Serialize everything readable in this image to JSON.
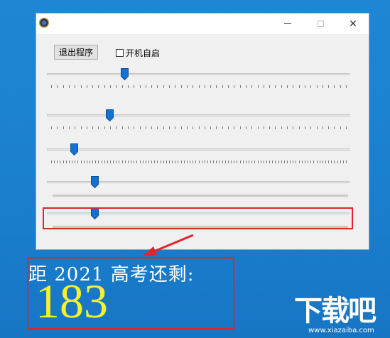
{
  "window": {
    "controls": {
      "close_glyph": "✕"
    }
  },
  "toolbar": {
    "exit_label": "退出程序",
    "autostart_label": "开机自启",
    "autostart_checked": false
  },
  "sliders": [
    {
      "value": 0.25,
      "has_ticks": true
    },
    {
      "value": 0.2,
      "has_ticks": true
    },
    {
      "value": 0.08,
      "has_ticks": true
    },
    {
      "value": 0.15,
      "has_ticks": false
    },
    {
      "value": 0.15,
      "has_ticks": false
    }
  ],
  "countdown": {
    "label": "距 2021 高考还剩:",
    "days": "183"
  },
  "watermark": {
    "brand": "下载吧",
    "url": "www.xiazaiba.com"
  },
  "colors": {
    "desktop": "#1a7fcf",
    "highlight": "#e0262b",
    "countdown_number": "#f6f22a",
    "thumb": "#1670d4"
  },
  "icons": {
    "app": "app-icon",
    "minimize": "minimize-icon",
    "maximize": "maximize-icon",
    "close": "close-icon",
    "arrow": "red-arrow-icon"
  }
}
